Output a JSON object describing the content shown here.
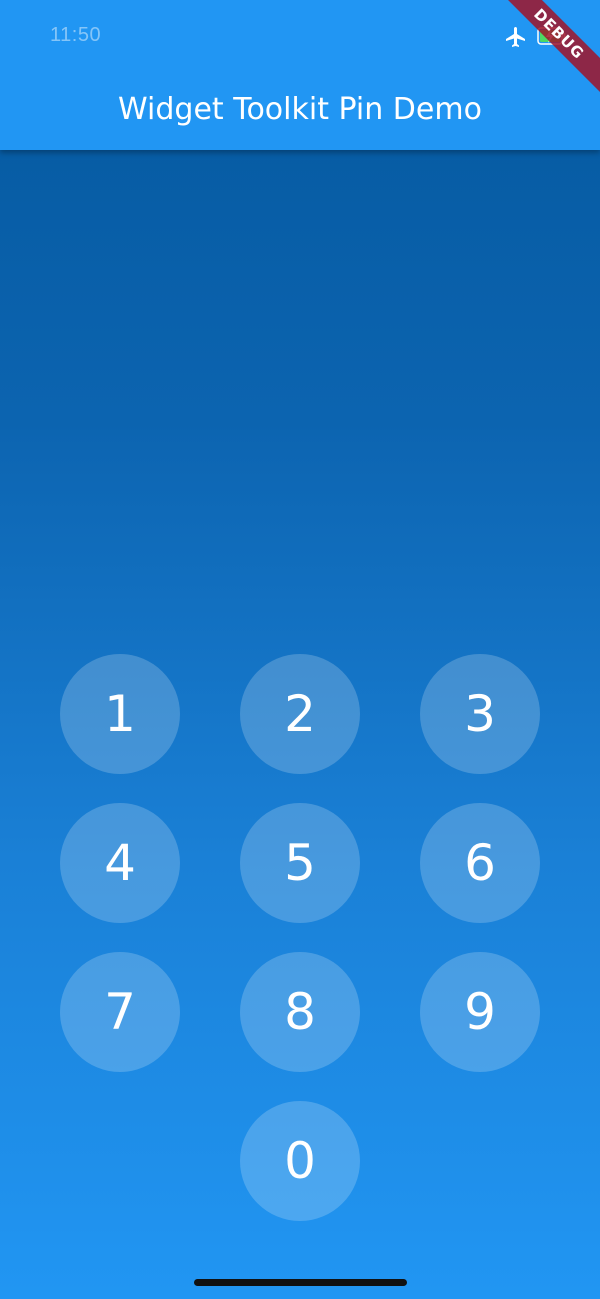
{
  "status_bar": {
    "time": "11:50",
    "icons": [
      "airplane-mode-icon",
      "battery-charging-icon"
    ]
  },
  "app_bar": {
    "title": "Widget Toolkit Pin Demo",
    "color": "#2196f3"
  },
  "debug_banner": {
    "label": "DEBUG"
  },
  "keypad": {
    "keys": [
      {
        "label": "1"
      },
      {
        "label": "2"
      },
      {
        "label": "3"
      },
      {
        "label": "4"
      },
      {
        "label": "5"
      },
      {
        "label": "6"
      },
      {
        "label": "7"
      },
      {
        "label": "8"
      },
      {
        "label": "9"
      },
      {
        "label": "0"
      }
    ]
  },
  "theme": {
    "background_top": "#04589e",
    "background_bottom": "#2196f3",
    "key_color": "rgba(255,255,255,0.2)",
    "text_color": "#ffffff"
  }
}
